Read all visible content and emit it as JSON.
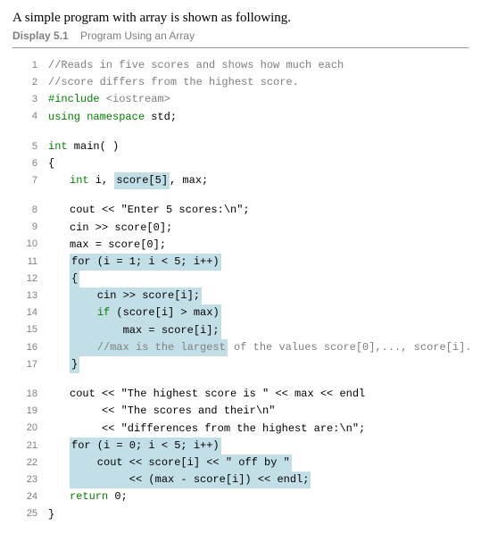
{
  "intro_text": "A simple program with array is shown as following.",
  "display_label": "Display 5.1",
  "display_title": "Program Using an Array",
  "lines": {
    "l1": "//Reads in five scores and shows how much each",
    "l2": "//score differs from the highest score.",
    "l3a": "#include",
    "l3b": " <iostream>",
    "l4a": "using namespace",
    "l4b": " std;",
    "l5a": "int",
    "l5b": " main( )",
    "l6": "{",
    "l7a": "int",
    "l7b": " i, ",
    "l7c": "score[5]",
    "l7d": ", max;",
    "l8": "cout << \"Enter 5 scores:\\n\";",
    "l9": "cin >> score[0];",
    "l10": "max = score[0];",
    "l11": "for (i = 1; i < 5; i++)",
    "l12": "{",
    "l13": "    cin >> score[i];",
    "l14a": "    ",
    "l14b": "if",
    "l14c": " (score[i] > max)",
    "l15": "        max = score[i];",
    "l16a": "    //max is the largest",
    "l16b": " of the values score[0],..., score[i].",
    "l17": "}",
    "l18": "cout << \"The highest score is \" << max << endl",
    "l19": "     << \"The scores and their\\n\"",
    "l20": "     << \"differences from the highest are:\\n\";",
    "l21": "for (i = 0; i < 5; i++)",
    "l22": "    cout << score[i] << \" off by \"",
    "l23": "         << (max - score[i]) << endl;",
    "l24a": "return",
    "l24b": " 0;",
    "l25": "}"
  },
  "line_numbers": {
    "n1": "1",
    "n2": "2",
    "n3": "3",
    "n4": "4",
    "n5": "5",
    "n6": "6",
    "n7": "7",
    "n8": "8",
    "n9": "9",
    "n10": "10",
    "n11": "11",
    "n12": "12",
    "n13": "13",
    "n14": "14",
    "n15": "15",
    "n16": "16",
    "n17": "17",
    "n18": "18",
    "n19": "19",
    "n20": "20",
    "n21": "21",
    "n22": "22",
    "n23": "23",
    "n24": "24",
    "n25": "25"
  }
}
